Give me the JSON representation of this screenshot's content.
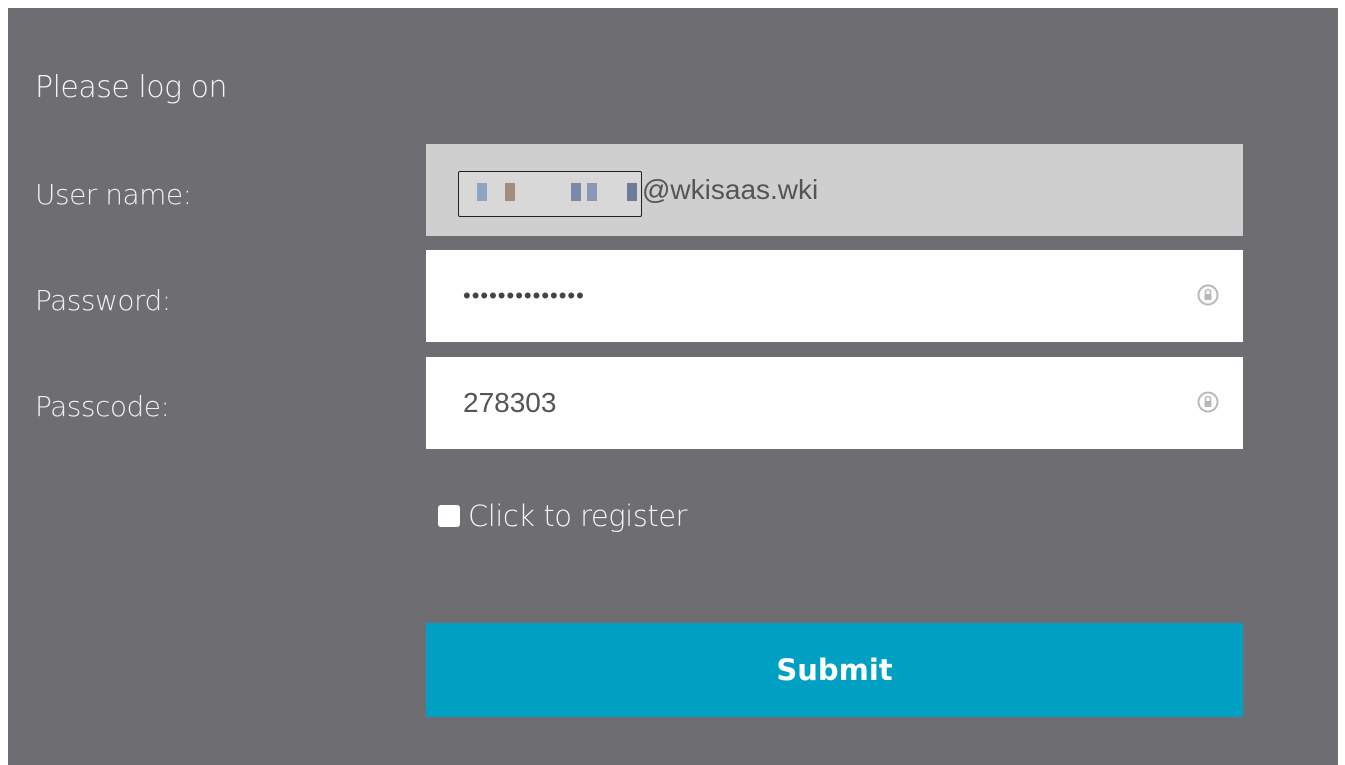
{
  "login": {
    "heading": "Please log on",
    "username_label": "User name:",
    "username_domain": "@wkisaas.wki",
    "password_label": "Password:",
    "password_value": "••••••••••••••",
    "passcode_label": "Passcode:",
    "passcode_value": "278303",
    "register_label": "Click to register",
    "register_checked": false,
    "submit_label": "Submit"
  },
  "icons": {
    "password_reveal": "password-reveal-icon",
    "passcode_reveal": "passcode-reveal-icon"
  },
  "colors": {
    "panel_background": "#6e6e72",
    "readonly_field": "#cfcfcf",
    "submit_background": "#00a0c2"
  }
}
